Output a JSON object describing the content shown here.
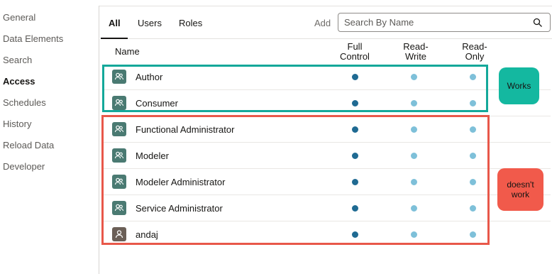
{
  "nav": {
    "items": [
      {
        "label": "General"
      },
      {
        "label": "Data Elements"
      },
      {
        "label": "Search"
      },
      {
        "label": "Access"
      },
      {
        "label": "Schedules"
      },
      {
        "label": "History"
      },
      {
        "label": "Reload Data"
      },
      {
        "label": "Developer"
      }
    ],
    "active": "Access"
  },
  "tabs": [
    {
      "label": "All"
    },
    {
      "label": "Users"
    },
    {
      "label": "Roles"
    }
  ],
  "toolbar": {
    "add_label": "Add",
    "search_placeholder": "Search By Name"
  },
  "columns": {
    "name": "Name",
    "full_control": "Full\nControl",
    "read_write": "Read-\nWrite",
    "read_only": "Read-\nOnly"
  },
  "rows": [
    {
      "name": "Author",
      "icon": "role-icon"
    },
    {
      "name": "Consumer",
      "icon": "role-icon"
    },
    {
      "name": "Functional Administrator",
      "icon": "role-icon"
    },
    {
      "name": "Modeler",
      "icon": "role-icon"
    },
    {
      "name": "Modeler Administrator",
      "icon": "role-icon"
    },
    {
      "name": "Service Administrator",
      "icon": "role-icon"
    },
    {
      "name": "andaj",
      "icon": "user-icon"
    }
  ],
  "annotations": {
    "works": "Works",
    "doesnt_work": "doesn't work"
  },
  "colors": {
    "full_dot": "#1f6a92",
    "partial_dot": "#7ec0d9",
    "works_box": "#14a89a",
    "doesnt_work_box": "#e8584a"
  }
}
